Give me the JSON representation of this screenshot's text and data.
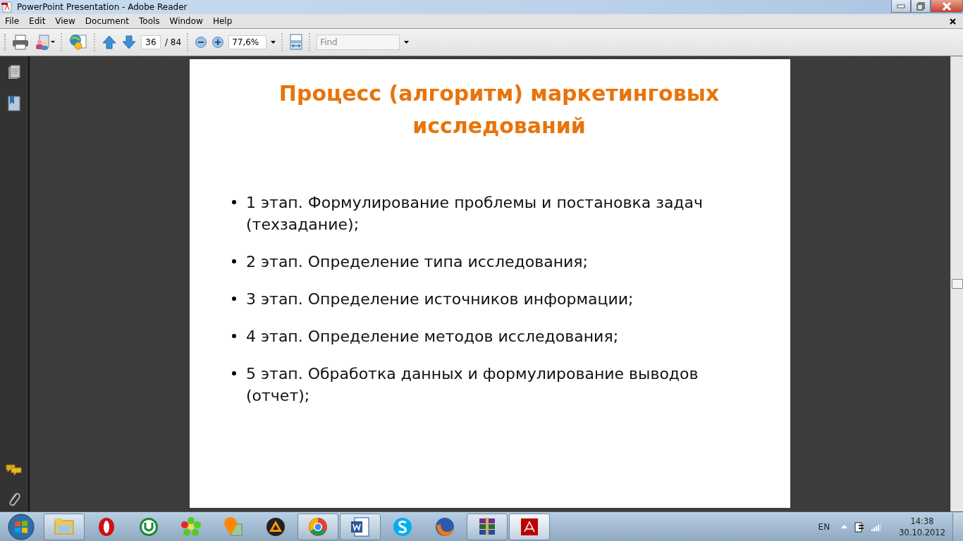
{
  "window": {
    "title": "PowerPoint Presentation - Adobe Reader"
  },
  "menu": [
    "File",
    "Edit",
    "View",
    "Document",
    "Tools",
    "Window",
    "Help"
  ],
  "toolbar": {
    "page": "36",
    "page_total": "/ 84",
    "zoom": "77,6%",
    "find": {
      "placeholder": "Find"
    }
  },
  "slide": {
    "title": "Процесс (алгоритм) маркетинговых исследований",
    "bullets": [
      "1 этап. Формулирование проблемы и постановка задач (техзадание);",
      "2 этап. Определение типа исследования;",
      "3 этап. Определение источников информации;",
      "4 этап. Определение методов исследования;",
      "5 этап. Обработка данных и формулирование выводов (отчет);"
    ]
  },
  "taskbar": {
    "buttons": [
      {
        "running": true
      },
      {
        "running": false
      },
      {
        "running": false
      },
      {
        "running": false
      },
      {
        "running": false
      },
      {
        "running": false
      },
      {
        "running": true
      },
      {
        "running": true
      },
      {
        "running": false
      },
      {
        "running": false
      },
      {
        "running": true
      },
      {
        "running": true,
        "selected": true
      }
    ],
    "language": "EN",
    "time": "14:38",
    "date": "30.10.2012"
  }
}
